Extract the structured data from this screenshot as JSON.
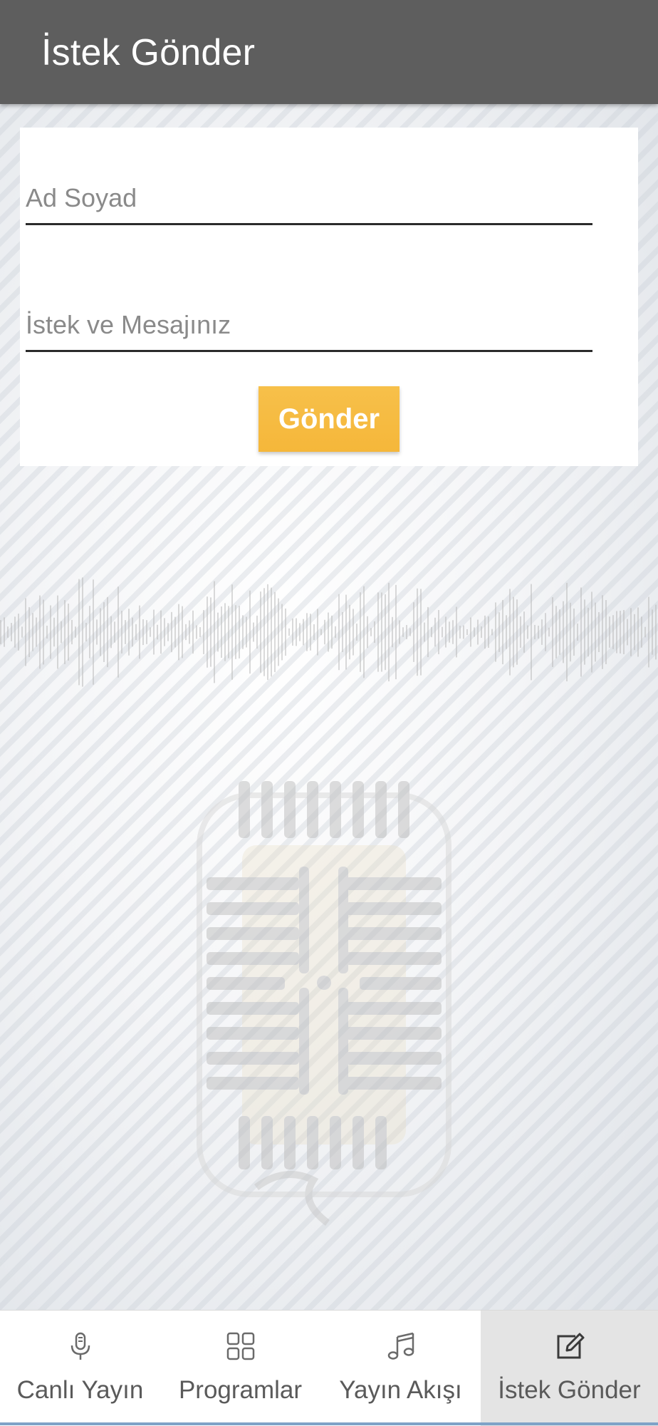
{
  "app_bar": {
    "title": "İstek Gönder"
  },
  "form": {
    "name_placeholder": "Ad Soyad",
    "name_value": "",
    "message_placeholder": "İstek ve Mesajınız",
    "message_value": "",
    "submit_label": "Gönder"
  },
  "bottom_nav": {
    "items": [
      {
        "label": "Canlı Yayın",
        "icon": "microphone-icon",
        "active": false
      },
      {
        "label": "Programlar",
        "icon": "grid-icon",
        "active": false
      },
      {
        "label": "Yayın Akışı",
        "icon": "music-note-icon",
        "active": false
      },
      {
        "label": "İstek Gönder",
        "icon": "edit-icon",
        "active": true
      }
    ]
  },
  "colors": {
    "app_bar": "#5e5e5e",
    "accent_button": "#f5b73a",
    "active_tab_bg": "#e4e4e4",
    "nav_bottom_line": "#7fa2c7"
  }
}
